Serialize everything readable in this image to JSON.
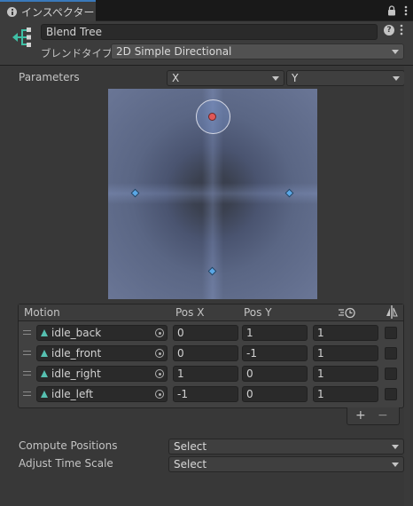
{
  "window": {
    "tab_title": "インスペクター",
    "icons": {
      "info": "info-icon",
      "lock": "lock-icon",
      "menu": "kebab-icon"
    }
  },
  "header": {
    "name": "Blend Tree",
    "blend_type_label": "ブレンドタイプ",
    "blend_type_value": "2D Simple Directional",
    "icons": {
      "object": "blend-tree-icon",
      "help": "help-icon",
      "presets": "presets-icon"
    }
  },
  "parameters": {
    "label": "Parameters",
    "param_x": "X",
    "param_y": "Y"
  },
  "blend_space": {
    "current_point": {
      "x": 0,
      "y": 1
    },
    "motions": [
      {
        "x": 0,
        "y": 1
      },
      {
        "x": 0,
        "y": -1
      },
      {
        "x": 1,
        "y": 0
      },
      {
        "x": -1,
        "y": 0
      }
    ],
    "accent": "#e05757",
    "node_color": "#5aa7e6"
  },
  "motion_list": {
    "headers": {
      "motion": "Motion",
      "pos_x": "Pos X",
      "pos_y": "Pos Y",
      "time_scale_icon": "time-scale-icon",
      "mirror_icon": "mirror-icon"
    },
    "rows": [
      {
        "name": "idle_back",
        "pos_x": "0",
        "pos_y": "1",
        "speed": "1"
      },
      {
        "name": "idle_front",
        "pos_x": "0",
        "pos_y": "-1",
        "speed": "1"
      },
      {
        "name": "idle_right",
        "pos_x": "1",
        "pos_y": "0",
        "speed": "1"
      },
      {
        "name": "idle_left",
        "pos_x": "-1",
        "pos_y": "0",
        "speed": "1"
      }
    ],
    "footer": {
      "add": "+",
      "remove": "−"
    }
  },
  "compute_positions": {
    "label": "Compute Positions",
    "value": "Select"
  },
  "adjust_time_scale": {
    "label": "Adjust Time Scale",
    "value": "Select"
  }
}
